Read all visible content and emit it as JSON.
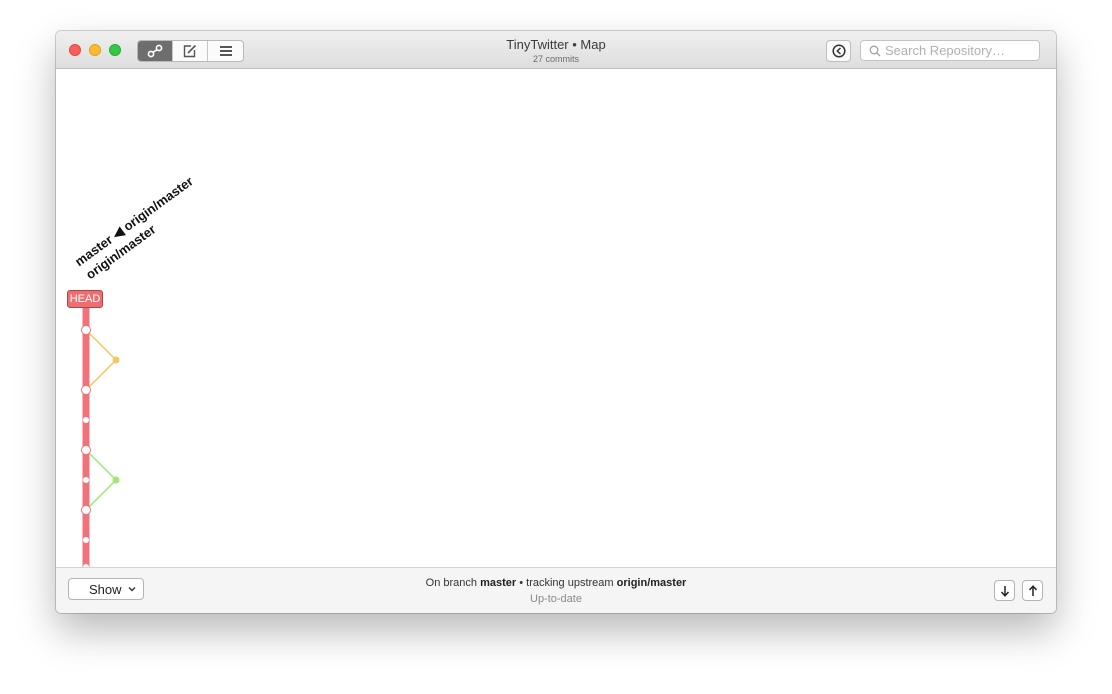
{
  "window": {
    "title": "TinyTwitter • Map",
    "subtitle": "27 commits"
  },
  "toolbar": {
    "view_buttons": [
      {
        "icon": "map-icon",
        "active": true
      },
      {
        "icon": "compose-icon",
        "active": false
      },
      {
        "icon": "list-icon",
        "active": false
      }
    ],
    "history_icon": "history-back-icon",
    "search_placeholder": "Search Repository…"
  },
  "graph": {
    "refs": [
      {
        "text": "master ◀ origin/master"
      },
      {
        "text": "origin/master"
      }
    ],
    "head_label": "HEAD",
    "colors": {
      "mainline": "#f0727a",
      "branch1": "#f2c766",
      "branch2": "#a3e57a"
    }
  },
  "footer": {
    "show_label": "Show",
    "status_prefix": "On branch",
    "branch": "master",
    "status_mid": "tracking upstream",
    "upstream": "origin/master",
    "status_sub": "Up-to-date",
    "pull_icon": "arrow-down-icon",
    "push_icon": "arrow-up-icon"
  }
}
